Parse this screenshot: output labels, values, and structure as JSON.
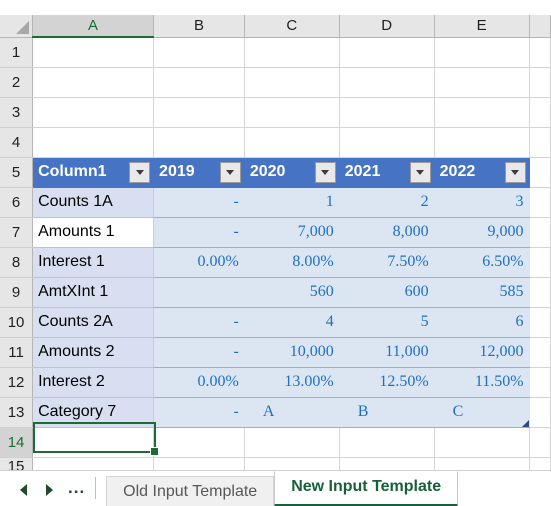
{
  "app": {
    "type": "spreadsheet"
  },
  "grid": {
    "column_headers": [
      "A",
      "B",
      "C",
      "D",
      "E"
    ],
    "selected_column": "A",
    "row_headers": [
      "1",
      "2",
      "3",
      "4",
      "5",
      "6",
      "7",
      "8",
      "9",
      "10",
      "11",
      "12",
      "13",
      "14",
      "15"
    ],
    "selected_row": "14",
    "active_cell": "A14",
    "select_all_icon": "select-all-triangle-icon"
  },
  "table": {
    "header_fill": "#4673C4",
    "header_text_color": "#FFFFFF",
    "band_fill": "#DCE6F2",
    "name_column_fill": "#D8DFF0",
    "value_text_color": "#1F6FC4",
    "filter_icon": "filter-dropdown-icon",
    "headers": [
      "Column1",
      "2019",
      "2020",
      "2021",
      "2022"
    ],
    "rows": [
      {
        "row": "6",
        "name": "Counts 1A",
        "name_fill": "banded",
        "values": [
          "-",
          "1",
          "2",
          "3"
        ],
        "align": "right"
      },
      {
        "row": "7",
        "name": "Amounts 1",
        "name_fill": "white",
        "values": [
          "-",
          "7,000",
          "8,000",
          "9,000"
        ],
        "align": "right"
      },
      {
        "row": "8",
        "name": "Interest 1",
        "name_fill": "banded",
        "values": [
          "0.00%",
          "8.00%",
          "7.50%",
          "6.50%"
        ],
        "align": "right"
      },
      {
        "row": "9",
        "name": "AmtXInt 1",
        "name_fill": "banded",
        "values": [
          "",
          "560",
          "600",
          "585"
        ],
        "align": "right"
      },
      {
        "row": "10",
        "name": "Counts 2A",
        "name_fill": "banded",
        "values": [
          "-",
          "4",
          "5",
          "6"
        ],
        "align": "right"
      },
      {
        "row": "11",
        "name": "Amounts 2",
        "name_fill": "banded",
        "values": [
          "-",
          "10,000",
          "11,000",
          "12,000"
        ],
        "align": "right"
      },
      {
        "row": "12",
        "name": "Interest 2",
        "name_fill": "banded",
        "values": [
          "0.00%",
          "13.00%",
          "12.50%",
          "11.50%"
        ],
        "align": "right"
      },
      {
        "row": "13",
        "name": "Category 7",
        "name_fill": "banded",
        "values": [
          "-",
          "A",
          "B",
          "C"
        ],
        "align": "mixed"
      }
    ]
  },
  "tabs": {
    "prev_label": "prev-sheet",
    "next_label": "next-sheet",
    "overflow_label": "...",
    "sheets": [
      {
        "name": "Old Input Template",
        "active": false
      },
      {
        "name": "New Input Template",
        "active": true
      }
    ]
  }
}
